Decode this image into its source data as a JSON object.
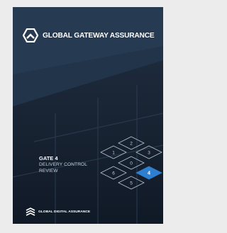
{
  "brand": {
    "name": "GLOBAL GATEWAY ASSURANCE",
    "logo_icon": "hexagon-chevron-logo-icon"
  },
  "cover": {
    "gate_title": "GATE 4",
    "subtitle_line1": "DELIVERY CONTROL",
    "subtitle_line2": "REVIEW"
  },
  "gates": [
    {
      "label": "1",
      "active": false
    },
    {
      "label": "2",
      "active": false
    },
    {
      "label": "3",
      "active": false
    },
    {
      "label": "0",
      "active": false
    },
    {
      "label": "6",
      "active": false
    },
    {
      "label": "4",
      "active": true
    },
    {
      "label": "5",
      "active": false
    }
  ],
  "footer": {
    "name": "GLOBAL DIGITAL ASSURANCE",
    "logo_icon": "layered-chevron-logo-icon"
  },
  "colors": {
    "page_bg": "#ececec",
    "cover_bg": "#243448",
    "active_gate": "#2f7fd0",
    "text": "#ffffff"
  }
}
